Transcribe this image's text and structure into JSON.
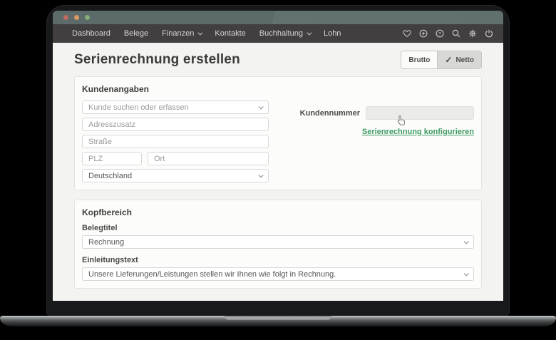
{
  "window": {
    "titlebar_dots": [
      "close",
      "minimize",
      "maximize"
    ]
  },
  "navbar": {
    "items": [
      {
        "label": "Dashboard",
        "chevron": false
      },
      {
        "label": "Belege",
        "chevron": false
      },
      {
        "label": "Finanzen",
        "chevron": true
      },
      {
        "label": "Kontakte",
        "chevron": false
      },
      {
        "label": "Buchhaltung",
        "chevron": true
      },
      {
        "label": "Lohn",
        "chevron": false
      }
    ],
    "icons": [
      "heart-icon",
      "plus-circle-icon",
      "help-circle-icon",
      "search-icon",
      "gear-icon",
      "power-icon"
    ]
  },
  "header": {
    "title": "Serienrechnung erstellen",
    "toggle": {
      "left_label": "Brutto",
      "right_label": "Netto",
      "selected": "Netto",
      "check_glyph": "✓"
    }
  },
  "customer": {
    "heading": "Kundenangaben",
    "customer_select": {
      "placeholder": "Kunde suchen oder erfassen"
    },
    "address": {
      "placeholder": "Adresszusatz"
    },
    "street": {
      "placeholder": "Straße"
    },
    "zip": {
      "placeholder": "PLZ"
    },
    "city": {
      "placeholder": "Ort"
    },
    "country": {
      "value": "Deutschland"
    },
    "customer_number": {
      "label": "Kundennummer",
      "value": ""
    },
    "configure_link": {
      "label": "Serienrechnung konfigurieren"
    }
  },
  "head_section": {
    "heading": "Kopfbereich",
    "document_title": {
      "label": "Belegtitel",
      "value": "Rechnung"
    },
    "intro_text": {
      "label": "Einleitungstext",
      "value": "Unsere Lieferungen/Leistungen stellen wir Ihnen wie folgt in Rechnung."
    }
  },
  "colors": {
    "accent_green": "#3e9b63",
    "navbar_bg": "#413f40",
    "titlebar_bg": "#5c6a6a",
    "toggle_selected_bg": "#d8d8d6",
    "content_bg": "#f3f3f1"
  }
}
